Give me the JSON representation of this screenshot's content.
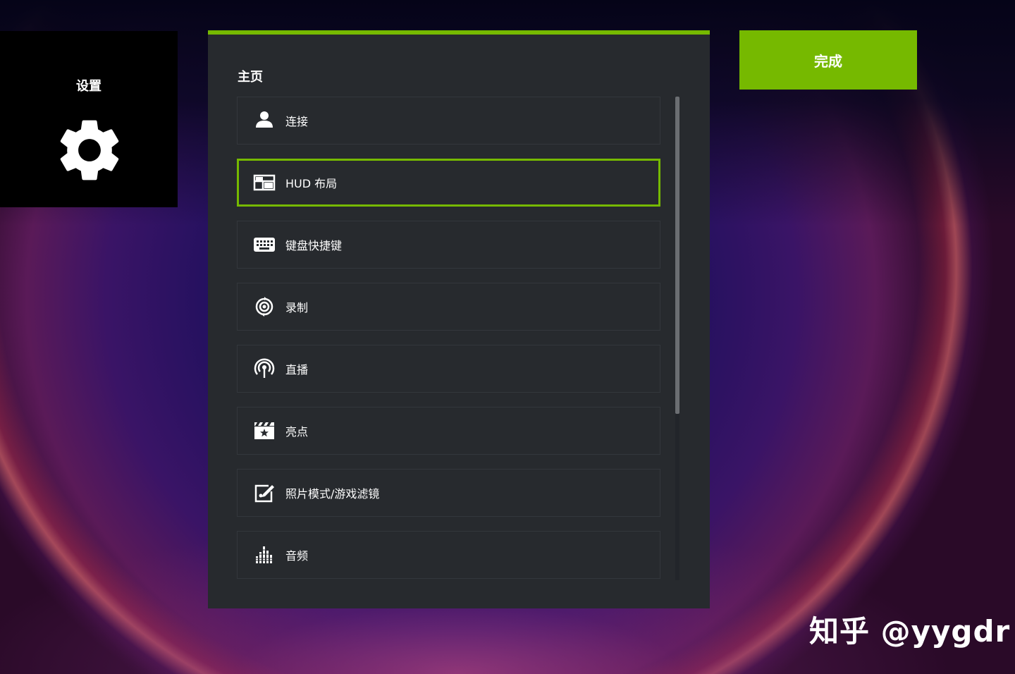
{
  "settings_tile": {
    "title": "设置",
    "icon": "gear-icon"
  },
  "done_button": {
    "label": "完成"
  },
  "panel": {
    "heading": "主页",
    "accent_color": "#76b900",
    "items": [
      {
        "label": "连接",
        "icon": "person-icon"
      },
      {
        "label": "HUD 布局",
        "icon": "layout-icon",
        "selected": true
      },
      {
        "label": "键盘快捷键",
        "icon": "keyboard-icon"
      },
      {
        "label": "录制",
        "icon": "record-icon"
      },
      {
        "label": "直播",
        "icon": "broadcast-icon"
      },
      {
        "label": "亮点",
        "icon": "clapperboard-star-icon"
      },
      {
        "label": "照片模式/游戏滤镜",
        "icon": "photo-edit-icon"
      },
      {
        "label": "音频",
        "icon": "audio-bars-icon"
      }
    ]
  },
  "watermark": "知乎 @yygdr"
}
